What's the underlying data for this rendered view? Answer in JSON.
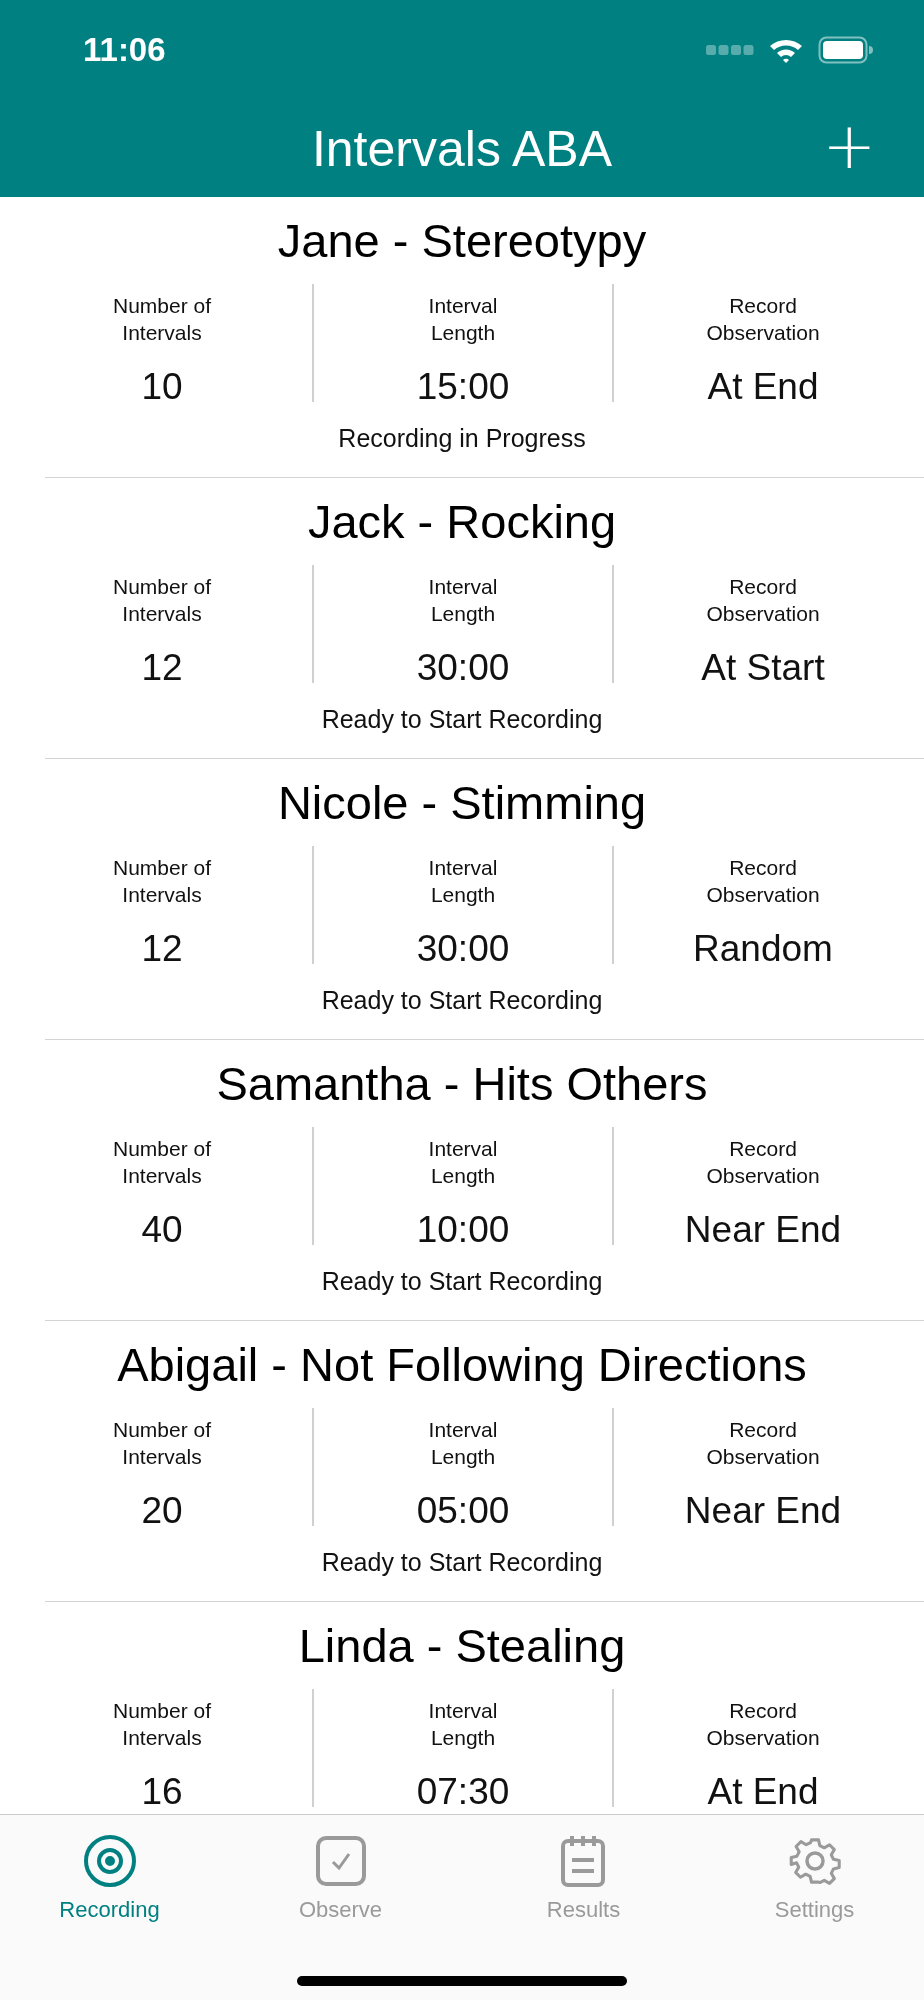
{
  "status_bar": {
    "time": "11:06"
  },
  "nav": {
    "title": "Intervals ABA",
    "action": "+"
  },
  "sessions": [
    {
      "title": "Jane - Stereotypy",
      "fields": [
        {
          "label": "Number of Intervals",
          "value": "10"
        },
        {
          "label": "Interval Length",
          "value": "15:00"
        },
        {
          "label": "Record Observation",
          "value": "At End"
        }
      ],
      "status": "Recording in Progress"
    },
    {
      "title": "Jack - Rocking",
      "fields": [
        {
          "label": "Number of Intervals",
          "value": "12"
        },
        {
          "label": "Interval Length",
          "value": "30:00"
        },
        {
          "label": "Record Observation",
          "value": "At Start"
        }
      ],
      "status": "Ready to Start Recording"
    },
    {
      "title": "Nicole - Stimming",
      "fields": [
        {
          "label": "Number of Intervals",
          "value": "12"
        },
        {
          "label": "Interval Length",
          "value": "30:00"
        },
        {
          "label": "Record Observation",
          "value": "Random"
        }
      ],
      "status": "Ready to Start Recording"
    },
    {
      "title": "Samantha - Hits Others",
      "fields": [
        {
          "label": "Number of Intervals",
          "value": "40"
        },
        {
          "label": "Interval Length",
          "value": "10:00"
        },
        {
          "label": "Record Observation",
          "value": "Near End"
        }
      ],
      "status": "Ready to Start Recording"
    },
    {
      "title": "Abigail - Not Following Directions",
      "fields": [
        {
          "label": "Number of Intervals",
          "value": "20"
        },
        {
          "label": "Interval Length",
          "value": "05:00"
        },
        {
          "label": "Record Observation",
          "value": "Near End"
        }
      ],
      "status": "Ready to Start Recording"
    },
    {
      "title": "Linda - Stealing",
      "fields": [
        {
          "label": "Number of Intervals",
          "value": "16"
        },
        {
          "label": "Interval Length",
          "value": "07:30"
        },
        {
          "label": "Record Observation",
          "value": "At End"
        }
      ]
    }
  ],
  "tabs": [
    {
      "label": "Recording",
      "kind": "target",
      "selected": true
    },
    {
      "label": "Observe",
      "kind": "check",
      "selected": false
    },
    {
      "label": "Results",
      "kind": "notepad",
      "selected": false
    },
    {
      "label": "Settings",
      "kind": "gear",
      "selected": false
    }
  ]
}
